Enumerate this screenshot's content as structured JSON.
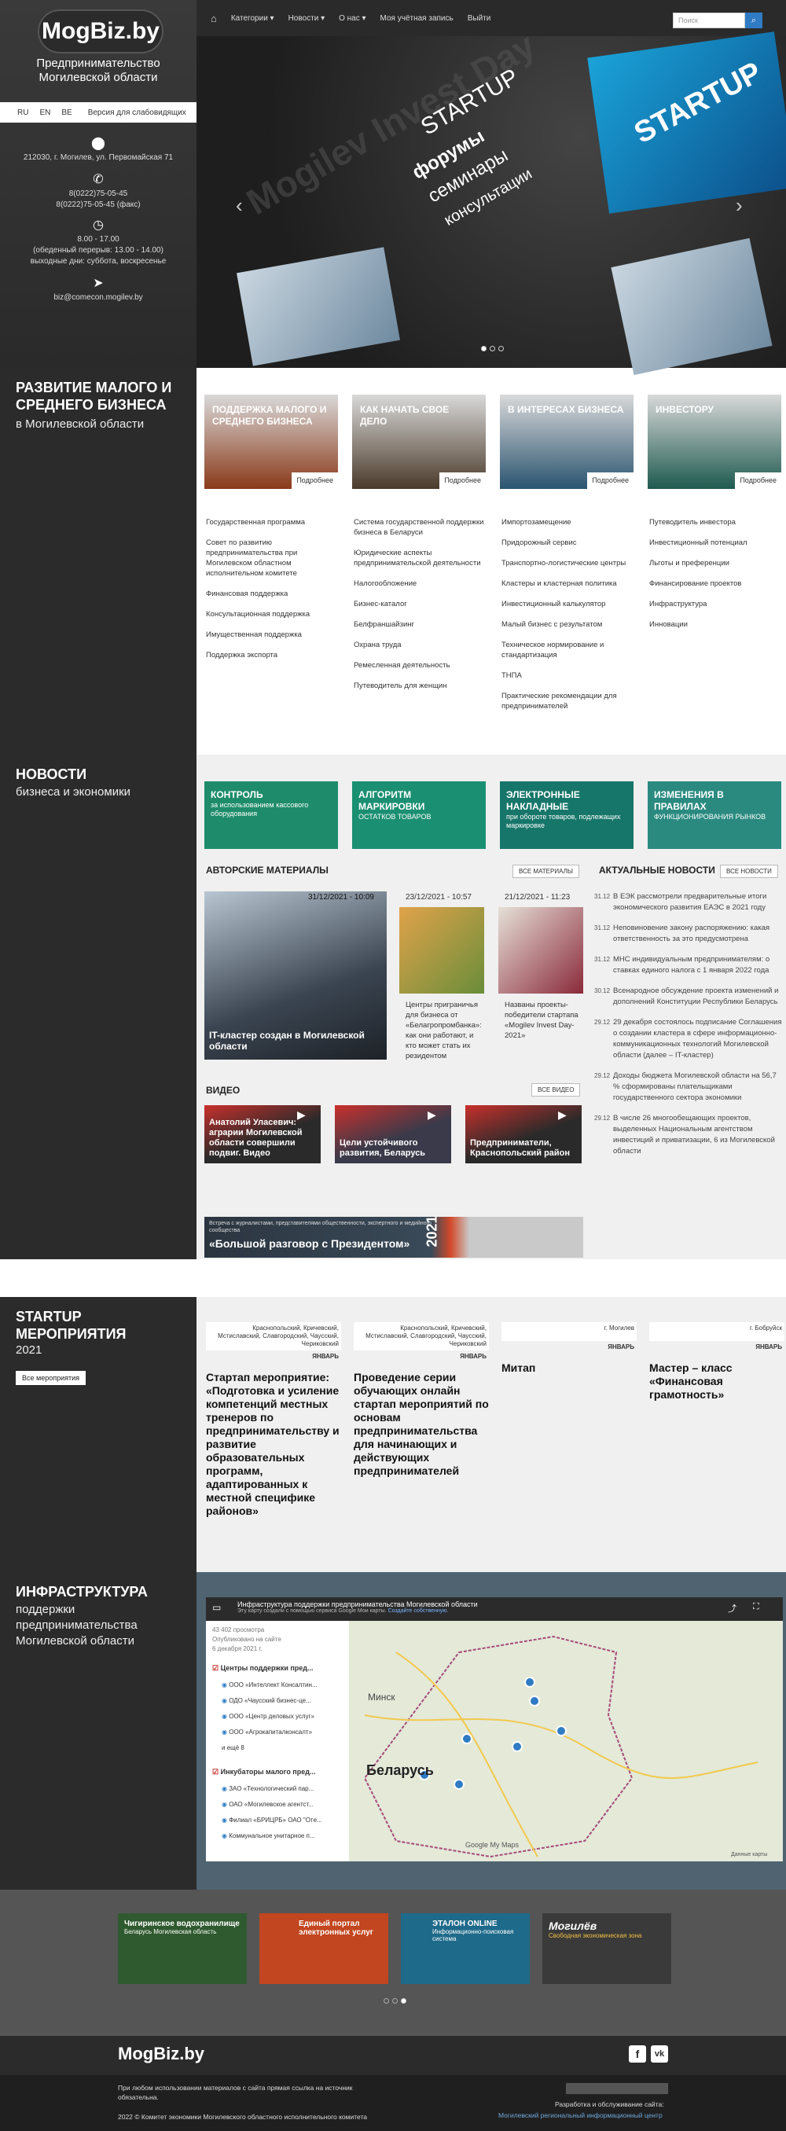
{
  "brand": {
    "logo": "MogBiz.by",
    "tagline": "Предпринимательство Могилевской области"
  },
  "lang": {
    "items": [
      "RU",
      "EN",
      "BE"
    ],
    "accessible": "Версия для слабовидящих"
  },
  "contacts": {
    "address": "212030, г. Могилев, ул. Первомайская 71",
    "phone1": "8(0222)75-05-45",
    "phone2": "8(0222)75-05-45 (факс)",
    "hours1": "8.00 - 17.00",
    "hours2": "(обеденный перерыв: 13.00 - 14.00)",
    "hours3": "выходные дни: суббота, воскресенье",
    "email": "biz@comecon.mogilev.by"
  },
  "nav": {
    "items": [
      "Категории ▾",
      "Новости ▾",
      "О нас ▾",
      "Моя учётная запись",
      "Выйти"
    ],
    "search_placeholder": "Поиск"
  },
  "slider": {
    "tag": "STARTUP",
    "line1": "форумы",
    "line2": "семинары",
    "line3": "консультации",
    "startup": "STARTUP",
    "watermark": "Mogilev Invest Day"
  },
  "dev": {
    "title": "РАЗВИТИЕ МАЛОГО И СРЕДНЕГО БИЗНЕСА",
    "sub": "в Могилевской области",
    "more": "Подробнее",
    "cards": [
      {
        "title": "ПОДДЕРЖКА МАЛОГО И СРЕДНЕГО БИЗНЕСА",
        "color": "#8a3a1a",
        "links": [
          "Государственная программа",
          "Совет по развитию предпринимательства при Могилевском областном исполнительном комитете",
          "Финансовая поддержка",
          "Консультационная поддержка",
          "Имущественная поддержка",
          "Поддержка экспорта"
        ]
      },
      {
        "title": "КАК НАЧАТЬ СВОЕ ДЕЛО",
        "color": "#4a3a2a",
        "links": [
          "Система государственной поддержки бизнеса в Беларуси",
          "Юридические аспекты предпринимательской деятельности",
          "Налогообложение",
          "Бизнес-каталог",
          "Белфраншайзинг",
          "Охрана труда",
          "Ремесленная деятельность",
          "Путеводитель для женщин"
        ]
      },
      {
        "title": "В ИНТЕРЕСАХ БИЗНЕСА",
        "color": "#2a5470",
        "links": [
          "Импортозамещение",
          "Придорожный сервис",
          "Транспортно-логистические центры",
          "Кластеры и кластерная политика",
          "Инвестиционный калькулятор",
          "Малый бизнес с результатом",
          "Техническое нормирование и стандартизация",
          "ТНПА",
          "Практические рекомендации для предпринимателей"
        ]
      },
      {
        "title": "ИНВЕСТОРУ",
        "color": "#1f5a50",
        "links": [
          "Путеводитель инвестора",
          "Инвестиционный потенциал",
          "Льготы и преференции",
          "Финансирование проектов",
          "Инфраструктура",
          "Инновации"
        ]
      }
    ]
  },
  "news": {
    "title": "НОВОСТИ",
    "sub": "бизнеса и экономики",
    "banners": [
      {
        "title": "КОНТРОЛЬ",
        "small": "за использованием кассового оборудования",
        "color": "#1e8c6a"
      },
      {
        "title": "АЛГОРИТМ МАРКИРОВКИ",
        "small": "ОСТАТКОВ ТОВАРОВ",
        "color": "#1b8f72"
      },
      {
        "title": "ЭЛЕКТРОННЫЕ НАКЛАДНЫЕ",
        "small": "при обороте товаров, подлежащих маркировке",
        "color": "#17766a"
      },
      {
        "title": "ИЗМЕНЕНИЯ В ПРАВИЛАХ",
        "small": "ФУНКЦИОНИРОВАНИЯ РЫНКОВ",
        "color": "#2a8a80"
      }
    ],
    "authors_title": "АВТОРСКИЕ МАТЕРИАЛЫ",
    "authors_btn": "ВСЕ МАТЕРИАЛЫ",
    "main_date": "31/12/2021 - 10:09",
    "main_title": "IT-кластер создан в Могилевской области",
    "a2_date": "23/12/2021 - 10:57",
    "a2_title": "Центры приграничья для бизнеса от «Белагропромбанка»: как они работают, и кто может стать их резидентом",
    "a3_date": "21/12/2021 - 11:23",
    "a3_title": "Названы проекты-победители стартапа «Mogilev Invest Day-2021»",
    "actual_title": "АКТУАЛЬНЫЕ НОВОСТИ",
    "actual_btn": "ВСЕ НОВОСТИ",
    "actual": [
      {
        "d": "31.12",
        "t": "В ЕЭК рассмотрели предварительные итоги экономического развития ЕАЭС в 2021 году"
      },
      {
        "d": "31.12",
        "t": "Неповиновение закону распоряжению: какая ответственность за это предусмотрена"
      },
      {
        "d": "31.12",
        "t": "МНС индивидуальным предпринимателям: о ставках единого налога с 1 января 2022 года"
      },
      {
        "d": "30.12",
        "t": "Всенародное обсуждение проекта изменений и дополнений Конституции Республики Беларусь"
      },
      {
        "d": "29.12",
        "t": "29 декабря состоялось подписание Соглашения о создании кластера в сфере информационно-коммуникационных технологий Могилевской области (далее – IT-кластер)"
      },
      {
        "d": "29.12",
        "t": "Доходы бюджета Могилевской области на 56,7 % сформированы плательщиками государственного сектора экономики"
      },
      {
        "d": "29.12",
        "t": "В числе 26 многообещающих проектов, выделенных Национальным агентством инвестиций и приватизации, 6 из Могилевской области"
      }
    ],
    "video_title": "ВИДЕО",
    "video_btn": "ВСЕ ВИДЕО",
    "videos": [
      "Анатолий Уласевич: аграрии Могилевской области совершили подвиг. Видео",
      "Цели устойчивого развития, Беларусь",
      "Предприниматели, Краснопольский район"
    ],
    "talk_small": "Встреча с журналистами, представителями общественности, экспертного и медийного сообщества",
    "talk_big": "«Большой разговор с Президентом»",
    "talk_year": "2021"
  },
  "events": {
    "title": "STARTUP МЕРОПРИЯТИЯ",
    "year": "2021",
    "btn": "Все мероприятия",
    "items": [
      {
        "place": "Краснопольский, Кричевский, Мстиславский, Славгородский, Чаусский, Чериковский",
        "month": "ЯНВАРЬ",
        "title": "Стартап мероприятие: «Подготовка и усиление компетенций местных тренеров по предпринимательству и развитие образовательных программ, адаптированных к местной специфике районов»"
      },
      {
        "place": "Краснопольский, Кричевский, Мстиславский, Славгородский, Чаусский, Чериковский",
        "month": "ЯНВАРЬ",
        "title": "Проведение серии обучающих онлайн стартап мероприятий по основам предпринимательства для начинающих и действующих предпринимателей"
      },
      {
        "place": "г. Могилев",
        "month": "ЯНВАРЬ",
        "title": "Митап"
      },
      {
        "place": "г. Бобруйск",
        "month": "ЯНВАРЬ",
        "title": "Мастер – класс «Финансовая грамотность»"
      }
    ]
  },
  "infra": {
    "title": "ИНФРАСТРУКТУРА",
    "sub": "поддержки предпринимательства Могилевской области",
    "map_title": "Инфраструктура поддержки предпринимательства Могилевской области",
    "map_note": "Эту карту создали с помощью сервиса Google Мои карты.",
    "map_link": "Создайте собственную.",
    "views": "43 402 просмотра",
    "published": "Опубликовано на сайте 6 декабря 2021 г.",
    "layer1": "Центры поддержки пред...",
    "layer1_items": [
      "ООО «Интеллект Консалтин...",
      "ОДО «Чаусский бизнес-це...",
      "ООО «Центр деловых услуг»",
      "ООО «Агрокапиталконсалт»"
    ],
    "layer1_more": "и ещё 8",
    "layer2": "Инкубаторы малого пред...",
    "layer2_items": [
      "ЗАО «Технологический пар...",
      "ОАО «Могилевское агентст...",
      "Филиал «БРИЦРБ» ОАО \"Отe...",
      "Коммунальное унитарное п..."
    ],
    "map_country": "Беларусь",
    "map_city": "Минск",
    "map_google": "Google My Maps",
    "map_credit": "Данные карты"
  },
  "partners": [
    {
      "title": "Чигиринское водохранилище",
      "sub": "Беларусь Могилевская область",
      "color": "#2f5a2f"
    },
    {
      "title": "Единый портал электронных услуг",
      "sub": "",
      "color": "#c2461f"
    },
    {
      "title": "ЭТАЛОН ONLINE",
      "sub": "Информационно-поисковая система",
      "color": "#1e6a8a"
    },
    {
      "title": "Могилёв",
      "sub": "Свободная экономическая зона",
      "color": "#3a3a3a"
    }
  ],
  "footer": {
    "logo": "MogBiz.by",
    "copy1": "При любом использовании материалов с сайта прямая ссылка на источник обязательна.",
    "copy2": "2022 © Комитет экономики Могилевского областного исполнительного комитета",
    "dev1": "Разработка и обслуживание сайта:",
    "dev2": "Могилевский региональный информационный центр",
    "social1": "f",
    "social2": "vk"
  }
}
